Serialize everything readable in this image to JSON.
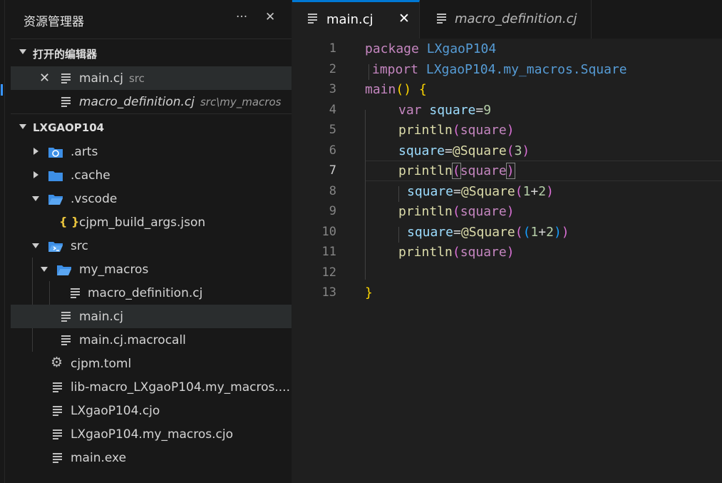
{
  "sidebar": {
    "title": "资源管理器",
    "more_label": "···",
    "close_label": "✕",
    "open_editors_label": "打开的编辑器",
    "project_label": "LXGAOP104",
    "open_editors": [
      {
        "name": "main.cj",
        "desc": "src"
      },
      {
        "name": "macro_definition.cj",
        "desc": "src\\my_macros"
      }
    ],
    "tree": {
      "arts": ".arts",
      "cache": ".cache",
      "vscode": ".vscode",
      "cjpm_build_args": "cjpm_build_args.json",
      "src": "src",
      "my_macros": "my_macros",
      "macro_definition": "macro_definition.cj",
      "main_cj": "main.cj",
      "main_macrocall": "main.cj.macrocall",
      "cjpm_toml": "cjpm.toml",
      "lib_macro": "lib-macro_LXgaoP104.my_macros....",
      "lx_cjo": "LXgaoP104.cjo",
      "lx_macros_cjo": "LXgaoP104.my_macros.cjo",
      "main_exe": "main.exe"
    }
  },
  "tabs": [
    {
      "label": "main.cj",
      "close": "✕"
    },
    {
      "label": "macro_definition.cj"
    }
  ],
  "code": {
    "line_numbers": [
      "1",
      "2",
      "3",
      "4",
      "5",
      "6",
      "7",
      "8",
      "9",
      "10",
      "11",
      "12",
      "13"
    ],
    "tokens": {
      "package": "package",
      "pkg_name": "LXgaoP104",
      "import": "import",
      "import_path": "LXgaoP104.my_macros.Square",
      "main": "main",
      "var": "var",
      "square": "square",
      "println": "println",
      "at_square": "@Square",
      "nine": "9",
      "three": "3",
      "one": "1",
      "two": "2",
      "eq": "=",
      "plus": "+",
      "lp": "(",
      "rp": ")",
      "lbrace": "{",
      "rbrace": "}",
      "main_parens": "()"
    }
  },
  "colors": {
    "accent": "#0078d4",
    "keyword": "#c586c0",
    "variable": "#9cdcfe",
    "function": "#dcdcaa",
    "number": "#b5cea8"
  }
}
